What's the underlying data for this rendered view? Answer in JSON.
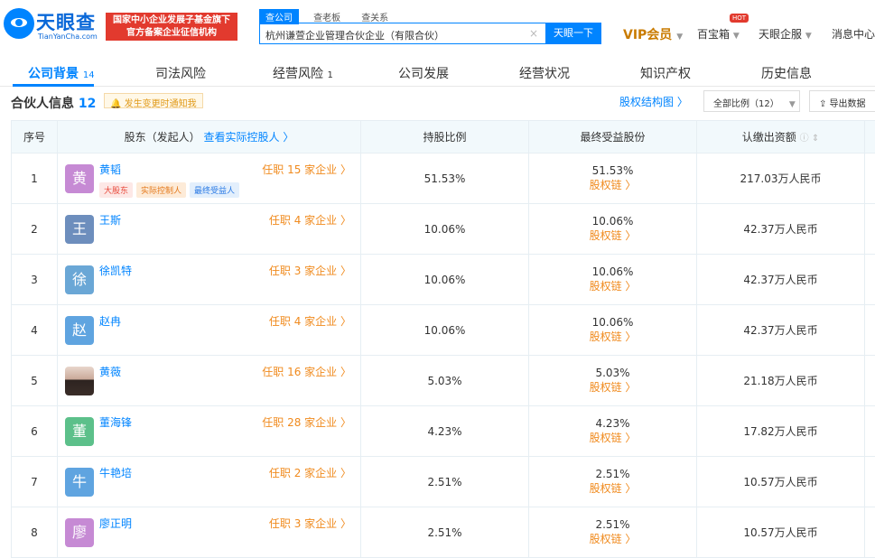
{
  "header": {
    "logo_name": "天眼查",
    "logo_url": "TianYanCha.com",
    "banner_line1": "国家中小企业发展子基金旗下",
    "banner_line2": "官方备案企业征信机构",
    "search_tabs": [
      "查公司",
      "查老板",
      "查关系"
    ],
    "search_value": "杭州谦萱企业管理合伙企业（有限合伙）",
    "search_clear": "×",
    "search_button": "天眼一下",
    "vip": "VIP会员",
    "nav": [
      "百宝箱",
      "天眼企服",
      "消息中心"
    ],
    "hot": "HOT",
    "caret": "▼"
  },
  "tabs": [
    {
      "label": "公司背景",
      "count": "14"
    },
    {
      "label": "司法风险",
      "count": ""
    },
    {
      "label": "经营风险",
      "count": "1"
    },
    {
      "label": "公司发展",
      "count": ""
    },
    {
      "label": "经营状况",
      "count": ""
    },
    {
      "label": "知识产权",
      "count": ""
    },
    {
      "label": "历史信息",
      "count": ""
    }
  ],
  "section": {
    "title": "合伙人信息",
    "count": "12",
    "notify": "🔔 发生变更时通知我",
    "equity_link": "股权结构图 〉",
    "select_label": "全部比例（12）",
    "export_label": "⇪ 导出数据"
  },
  "table": {
    "headers": {
      "seq": "序号",
      "shareholder": "股东（发起人）",
      "actual_controller_link": "查看实际控股人 〉",
      "ratio": "持股比例",
      "final_ratio": "最终受益股份",
      "capital": "认缴出资额",
      "capital_icon": "ⓘ ⇕"
    },
    "rows": [
      {
        "seq": "1",
        "avatar": "黄",
        "name": "黄韬",
        "jobs": "任职 15 家企业 〉",
        "tags": [
          "大股东",
          "实际控制人",
          "最终受益人"
        ],
        "ratio": "51.53%",
        "final": "51.53%",
        "chain": "股权链 〉",
        "capital": "217.03万人民币"
      },
      {
        "seq": "2",
        "avatar": "王",
        "name": "王斯",
        "jobs": "任职 4 家企业 〉",
        "tags": [],
        "ratio": "10.06%",
        "final": "10.06%",
        "chain": "股权链 〉",
        "capital": "42.37万人民币"
      },
      {
        "seq": "3",
        "avatar": "徐",
        "name": "徐凯特",
        "jobs": "任职 3 家企业 〉",
        "tags": [],
        "ratio": "10.06%",
        "final": "10.06%",
        "chain": "股权链 〉",
        "capital": "42.37万人民币"
      },
      {
        "seq": "4",
        "avatar": "赵",
        "name": "赵冉",
        "jobs": "任职 4 家企业 〉",
        "tags": [],
        "ratio": "10.06%",
        "final": "10.06%",
        "chain": "股权链 〉",
        "capital": "42.37万人民币"
      },
      {
        "seq": "5",
        "avatar": "",
        "name": "黄薇",
        "jobs": "任职 16 家企业 〉",
        "tags": [],
        "ratio": "5.03%",
        "final": "5.03%",
        "chain": "股权链 〉",
        "capital": "21.18万人民币"
      },
      {
        "seq": "6",
        "avatar": "董",
        "name": "董海锋",
        "jobs": "任职 28 家企业 〉",
        "tags": [],
        "ratio": "4.23%",
        "final": "4.23%",
        "chain": "股权链 〉",
        "capital": "17.82万人民币"
      },
      {
        "seq": "7",
        "avatar": "牛",
        "name": "牛艳培",
        "jobs": "任职 2 家企业 〉",
        "tags": [],
        "ratio": "2.51%",
        "final": "2.51%",
        "chain": "股权链 〉",
        "capital": "10.57万人民币"
      },
      {
        "seq": "8",
        "avatar": "廖",
        "name": "廖正明",
        "jobs": "任职 3 家企业 〉",
        "tags": [],
        "ratio": "2.51%",
        "final": "2.51%",
        "chain": "股权链 〉",
        "capital": "10.57万人民币"
      }
    ]
  },
  "colors": {
    "accent": "#0084ff",
    "orange": "#f08a1d",
    "avatars": [
      "#c68ad4",
      "#6d8ebd",
      "#6aa7d6",
      "#5fa4e0",
      "",
      "#5cc08a",
      "#5fa4e0",
      "#c68ad4"
    ]
  }
}
